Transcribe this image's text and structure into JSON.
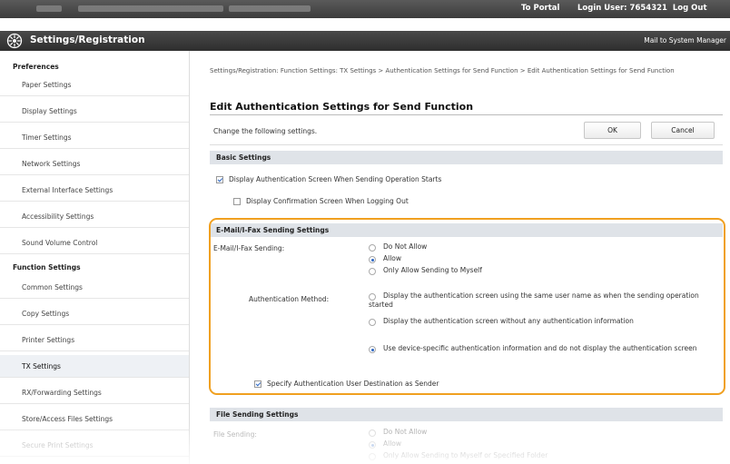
{
  "topbar": {
    "portal_link": "To Portal",
    "login_user": "Login User: 7654321",
    "logout": "Log Out"
  },
  "header": {
    "title": "Settings/Registration",
    "mail_link": "Mail to System Manager",
    "logo_icon": "settings-wheel-icon"
  },
  "sidebar": {
    "preferences_label": "Preferences",
    "preferences": [
      "Paper Settings",
      "Display Settings",
      "Timer Settings",
      "Network Settings",
      "External Interface Settings",
      "Accessibility Settings",
      "Sound Volume Control"
    ],
    "function_label": "Function Settings",
    "functions": [
      "Common Settings",
      "Copy Settings",
      "Printer Settings",
      "TX Settings",
      "RX/Forwarding Settings",
      "Store/Access Files Settings",
      "Secure Print Settings"
    ],
    "active": "TX Settings"
  },
  "main": {
    "breadcrumb": "Settings/Registration: Function Settings: TX Settings > Authentication Settings for Send Function > Edit Authentication Settings for Send Function",
    "page_title": "Edit Authentication Settings for Send Function",
    "instruction": "Change the following settings.",
    "ok_label": "OK",
    "cancel_label": "Cancel",
    "basic": {
      "header": "Basic Settings",
      "display_auth_screen": "Display Authentication Screen When Sending Operation Starts",
      "display_auth_screen_checked": true,
      "display_confirm": "Display Confirmation Screen When Logging Out",
      "display_confirm_checked": false
    },
    "email": {
      "header": "E-Mail/I-Fax Sending Settings",
      "sending_label": "E-Mail/I-Fax Sending:",
      "sending_options": [
        "Do Not Allow",
        "Allow",
        "Only Allow Sending to Myself"
      ],
      "sending_selected": 1,
      "auth_label": "Authentication Method:",
      "auth_options": [
        "Display the authentication screen using the same user name as when the sending operation started",
        "Display the authentication screen without any authentication information",
        "Use device-specific authentication information and do not display the authentication screen"
      ],
      "auth_selected": 2,
      "specify_dest": "Specify Authentication User Destination as Sender",
      "specify_dest_checked": true
    },
    "file": {
      "header": "File Sending Settings",
      "sending_label": "File Sending:",
      "sending_options": [
        "Do Not Allow",
        "Allow",
        "Only Allow Sending to Myself or Specified Folder"
      ],
      "sending_selected": 1
    }
  },
  "colors": {
    "highlight": "#f0a020",
    "section_header": "#dfe3e8",
    "accent": "#2a66c4"
  }
}
